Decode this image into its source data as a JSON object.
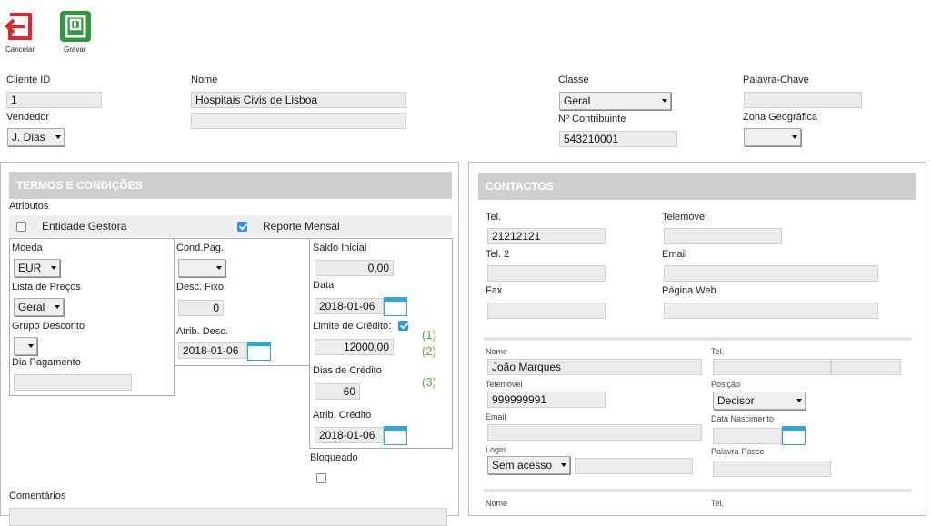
{
  "toolbar": {
    "cancel_label": "Cancelar",
    "save_label": "Gravar"
  },
  "header": {
    "cliente_id_label": "Cliente ID",
    "cliente_id": "1",
    "vendedor_label": "Vendedor",
    "vendedor": "J. Dias",
    "nome_label": "Nome",
    "nome": "Hospitais Civis de Lisboa",
    "nome2": "",
    "classe_label": "Classe",
    "classe": "Geral",
    "contribuinte_label": "Nº Contribuinte",
    "contribuinte": "543210001",
    "palavra_chave_label": "Palavra-Chave",
    "palavra_chave": "",
    "zona_label": "Zona Geográfica",
    "zona": ""
  },
  "termos": {
    "title": "TERMOS E CONDIÇÕES",
    "atributos_label": "Atributos",
    "entidade_gestora_label": "Entidade Gestora",
    "entidade_gestora_checked": false,
    "reporte_mensal_label": "Reporte Mensal",
    "reporte_mensal_checked": true,
    "moeda_label": "Moeda",
    "moeda": "EUR",
    "lista_precos_label": "Lista de Preços",
    "lista_precos": "Geral",
    "grupo_desconto_label": "Grupo Desconto",
    "grupo_desconto": "",
    "dia_pagamento_label": "Dia Pagamento",
    "dia_pagamento": "",
    "cond_pag_label": "Cond.Pag.",
    "cond_pag": "",
    "desc_fixo_label": "Desc. Fixo",
    "desc_fixo": "0",
    "atrib_desc_label": "Atrib. Desc.",
    "atrib_desc": "2018-01-06",
    "saldo_inicial_label": "Saldo Inicial",
    "saldo_inicial": "0,00",
    "data_label": "Data",
    "data": "2018-01-06",
    "limite_credito_label": "Limite de Crédito:",
    "limite_credito_checked": true,
    "limite_credito": "12000,00",
    "dias_credito_label": "Dias de Crédito",
    "dias_credito": "60",
    "atrib_credito_label": "Atrib. Crédito",
    "atrib_credito": "2018-01-06",
    "bloqueado_label": "Bloqueado",
    "bloqueado_checked": false,
    "comentarios_label": "Comentários",
    "notes": [
      "(1)",
      "(2)",
      "(3)"
    ]
  },
  "contactos": {
    "title": "CONTACTOS",
    "tel_label": "Tel.",
    "tel": "21212121",
    "telemovel_label": "Telemóvel",
    "telemovel": "",
    "tel2_label": "Tel. 2",
    "tel2": "",
    "email_label": "Email",
    "email": "",
    "fax_label": "Fax",
    "fax": "",
    "pagina_web_label": "Página Web",
    "pagina_web": "",
    "person": {
      "nome_label": "Nome",
      "nome": "João Marques",
      "tel_label": "Tel.",
      "tel": "",
      "tel_ext": "",
      "telemovel_label": "Telemóvel",
      "telemovel": "999999991",
      "posicao_label": "Posição",
      "posicao": "Decisor",
      "email_label": "Email",
      "email": "",
      "data_nascimento_label": "Data Nascimento",
      "data_nascimento": "",
      "login_label": "Login",
      "login": "Sem acesso",
      "login_extra": "",
      "palavra_passe_label": "Palavra-Passe",
      "palavra_passe": ""
    },
    "next_nome_label": "Nome",
    "next_tel_label": "Tel."
  },
  "colors": {
    "cancel": "#e8232a",
    "save": "#2c9b3a",
    "header_bg": "#cfcfcf",
    "calendar": "#2aa7dd",
    "checkbox": "#2c8ef0",
    "note": "#5fa93a"
  }
}
